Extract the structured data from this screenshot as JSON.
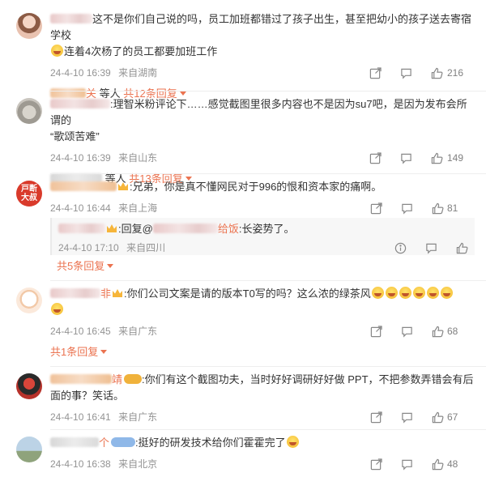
{
  "comments": [
    {
      "text_a": "这不是你们自己说的吗，员工加班都错过了孩子出生，甚至把幼小的孩子送去寄宿学校",
      "text_b": "连着4次杨了的员工都要加班工作",
      "time": "24-4-10 16:39",
      "location": "来自湖南",
      "likes": "216",
      "reply_user_tail": "关",
      "reply_prefix": "等人",
      "reply_count": "共12条回复"
    },
    {
      "text_a": ":理智米粉评论下……感觉截图里很多内容也不是因为su7吧，是因为发布会所谓的",
      "text_b": "“歌颂苦难”",
      "time": "24-4-10 16:39",
      "location": "来自山东",
      "likes": "149",
      "reply_prefix": "等人",
      "reply_count": "共13条回复"
    },
    {
      "avatar_text": "戸断 大叔",
      "text_a": ":兄弟，你是真不懂网民对于996的恨和资本家的痛啊。",
      "time": "24-4-10 16:44",
      "location": "来自上海",
      "likes": "81",
      "sub_reply_text_a": ":回复@",
      "sub_reply_mention_tail": "给饭",
      "sub_reply_text_b": ":长姿势了。",
      "sub_time": "24-4-10 17:10",
      "sub_location": "来自四川",
      "reply_count": "共5条回复"
    },
    {
      "name_tail": "非",
      "text_a": ":你们公司文案是请的版本T0写的吗？这么浓的绿茶风",
      "time": "24-4-10 16:45",
      "location": "来自广东",
      "likes": "68",
      "reply_count": "共1条回复"
    },
    {
      "name_tail": "靖",
      "text_a": ":你们有这个截图功夫，当时好好调研好好做 PPT，不把参数弄错会有后",
      "text_b": "面的事？笑话。",
      "time": "24-4-10 16:41",
      "location": "来自广东",
      "likes": "67"
    },
    {
      "name_tail": "个",
      "text_a": ":挺好的研发技术给你们霍霍完了",
      "time": "24-4-10 16:38",
      "location": "来自北京",
      "likes": "48"
    }
  ],
  "icons": {
    "share": "share-icon",
    "comment": "comment-icon",
    "like": "thumbs-up-icon"
  }
}
